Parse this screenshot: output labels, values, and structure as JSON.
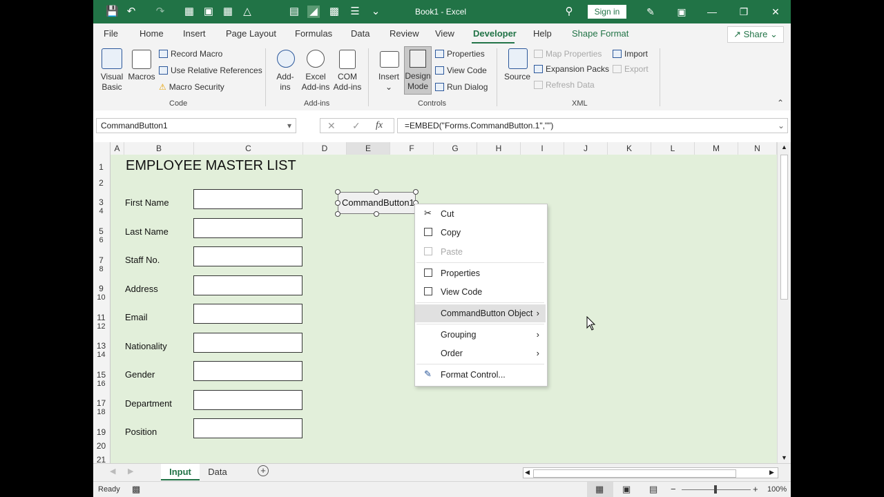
{
  "window": {
    "title": "Book1 - Excel",
    "sign_in": "Sign in"
  },
  "tabs": [
    "File",
    "Home",
    "Insert",
    "Page Layout",
    "Formulas",
    "Data",
    "Review",
    "View",
    "Developer",
    "Help",
    "Shape Format"
  ],
  "share": "Share",
  "ribbon": {
    "code": {
      "visual_basic": "Visual Basic",
      "macros": "Macros",
      "record_macro": "Record Macro",
      "relative_refs": "Use Relative References",
      "macro_security": "Macro Security",
      "group": "Code"
    },
    "addins": {
      "addins": "Add-ins",
      "excel_addins": "Excel Add-ins",
      "com_addins": "COM Add-ins",
      "group": "Add-ins"
    },
    "controls": {
      "insert": "Insert",
      "design_mode": "Design Mode",
      "properties": "Properties",
      "view_code": "View Code",
      "run_dialog": "Run Dialog",
      "group": "Controls"
    },
    "xml": {
      "source": "Source",
      "map_properties": "Map Properties",
      "expansion_packs": "Expansion Packs",
      "refresh_data": "Refresh Data",
      "import": "Import",
      "export": "Export",
      "group": "XML"
    }
  },
  "formula_bar": {
    "name_box": "CommandButton1",
    "fx": "fx",
    "formula": "=EMBED(\"Forms.CommandButton.1\",\"\")"
  },
  "columns": [
    "A",
    "B",
    "C",
    "D",
    "E",
    "F",
    "G",
    "H",
    "I",
    "J",
    "K",
    "L",
    "M",
    "N"
  ],
  "rows": [
    "1",
    "2",
    "3",
    "4",
    "5",
    "6",
    "7",
    "8",
    "9",
    "10",
    "11",
    "12",
    "13",
    "14",
    "15",
    "16",
    "17",
    "18",
    "19",
    "20",
    "21"
  ],
  "sheet": {
    "title": "EMPLOYEE MASTER LIST",
    "fields": [
      "First Name",
      "Last Name",
      "Staff No.",
      "Address",
      "Email",
      "Nationality",
      "Gender",
      "Department",
      "Position"
    ],
    "command_button": "CommandButton1"
  },
  "context_menu": {
    "cut": "Cut",
    "copy": "Copy",
    "paste": "Paste",
    "properties": "Properties",
    "view_code": "View Code",
    "command_button_object": "CommandButton Object",
    "grouping": "Grouping",
    "order": "Order",
    "format_control": "Format Control..."
  },
  "sheet_tabs": [
    "Input",
    "Data"
  ],
  "status": {
    "ready": "Ready",
    "zoom": "100%"
  },
  "colors": {
    "excel_green": "#217346",
    "sheet_fill": "#e2efda"
  }
}
